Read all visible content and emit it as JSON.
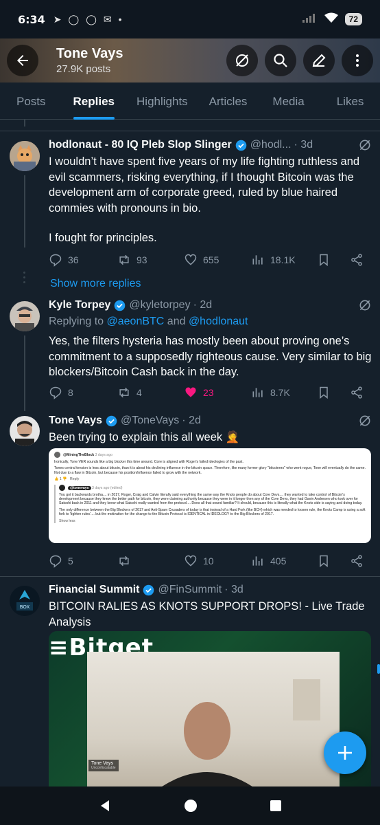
{
  "status_bar": {
    "time": "6:34",
    "battery": "72"
  },
  "header": {
    "title": "Tone Vays",
    "subtitle": "27.9K posts"
  },
  "tabs": [
    "Posts",
    "Replies",
    "Highlights",
    "Articles",
    "Media",
    "Likes"
  ],
  "tweets": [
    {
      "name": "hodlonaut - 80 IQ Pleb Slop Slinger",
      "handle": "@hodl...",
      "time": "· 3d",
      "text": "I wouldn’t have spent five years of my life fighting ruthless and evil scammers, risking everything, if I thought Bitcoin was the development arm of corporate greed, ruled by blue haired commies with pronouns in bio.",
      "text2": "I fought for principles.",
      "replies": "36",
      "reposts": "93",
      "likes": "655",
      "views": "18.1K"
    },
    {
      "name": "Kyle Torpey",
      "handle": "@kyletorpey",
      "time": "· 2d",
      "replying_prefix": "Replying to ",
      "replying_to_1": "@aeonBTC",
      "replying_and": " and ",
      "replying_to_2": "@hodlonaut",
      "text": "Yes, the filters hysteria has mostly been about proving one’s commitment to a supposedly righteous cause. Very similar to big blockers/Bitcoin Cash back in the day.",
      "replies": "8",
      "reposts": "4",
      "likes": "23",
      "views": "8.7K"
    },
    {
      "name": "Tone Vays",
      "handle": "@ToneVays",
      "time": "· 2d",
      "text": "Been trying to explain this all week 🤦",
      "replies": "5",
      "reposts": "",
      "likes": "10",
      "views": "405",
      "embed": {
        "user1": "@MiningTheBlock",
        "user1_time": "3 days ago",
        "line1": "Ironically, Tone VER sounds like a big blocker this time around. Core is aligned with Roger's failed ideologies of the past.",
        "line2": "Tones central tension is less about bitcoin, than it is about his declining influence in the bitcoin space. Therefore, like many former glory \"bitcoiners\" who went rogue, Tone will eventually do the same. Not due to a flaw in Bitcoin, but because his position/influence failed to grow with the network.",
        "reply_label": "Reply",
        "user2": "@tonevays",
        "user2_time": "3 days ago (edited)",
        "line3": "You got it backwards brotha.... in 2017, Roger, Craig and Calvin literally said everything the same way the Knots people do about Core Devs.... they wanted to take control of Bitcoin's development because they knew the better path for bitcoin, they were claiming authority because they were in it longer then any of the Core Devs, they had Gavin Andresen who took over for Satoshi back in 2011 and they knew what Satoshi really wanted from the protocol.... Does all that sound familiar? It should, because this is literally what the Knots side is saying and doing today.",
        "line4": "The only difference between the Big Blockers of 2017 and Anti-Spam Crusaders of today is that instead of a Hard Fork (like BCH) which was needed to loosen rule, the Knots Camp is using a soft fork to 'tighten rules'.... but the motivation for the change to the Bitcoin Protocol is IDENTICAL in IDEOLOGY to the Big Blockers of 2017.",
        "show_less": "Show less"
      }
    },
    {
      "name": "Financial Summit",
      "handle": "@FinSummit",
      "time": "· 3d",
      "text": "BITCOIN RALIES AS KNOTS SUPPORT DROPS! - Live Trade Analysis",
      "video": {
        "brand": "Bitget",
        "name_tag": "Tone Vays",
        "name_sub": "Unconfiscatable"
      }
    }
  ],
  "show_more_replies": "Show more replies",
  "colors": {
    "accent": "#1d9bf0",
    "like": "#f91880",
    "background": "#15202b"
  }
}
